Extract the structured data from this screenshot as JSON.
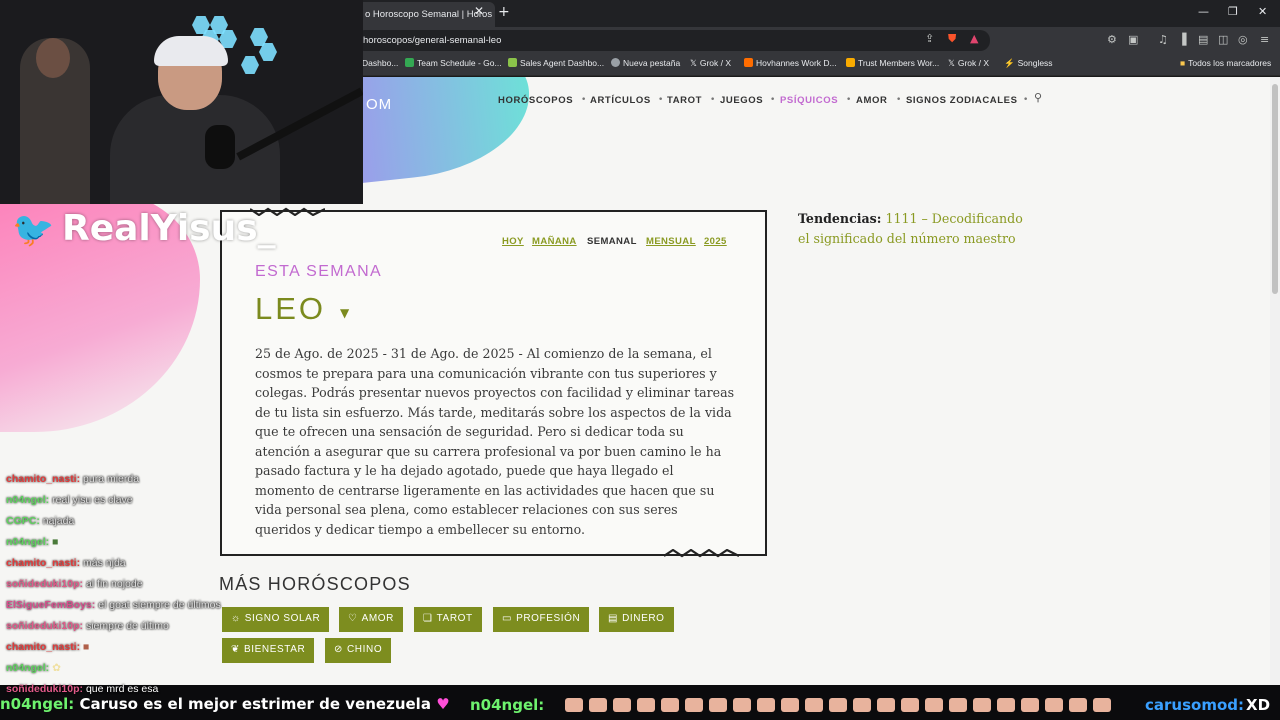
{
  "browser": {
    "tab_title": "o Horoscopo Semanal | Horos",
    "url": "horoscopos/general-semanal-leo",
    "bookmarks": [
      {
        "label": "Dashbo...",
        "color": "#4caf50"
      },
      {
        "label": "Team Schedule - Go...",
        "color": "#34a853"
      },
      {
        "label": "Sales Agent Dashbo...",
        "color": "#8bc34a"
      },
      {
        "label": "Nueva pestaña",
        "color": "#9aa0a6"
      },
      {
        "label": "Grok / X",
        "color": "#e8eaed"
      },
      {
        "label": "Hovhannes Work D...",
        "color": "#ff6d00"
      },
      {
        "label": "Trust Members Wor...",
        "color": "#f9ab00"
      },
      {
        "label": "Grok / X",
        "color": "#e8eaed"
      },
      {
        "label": "Songless",
        "color": "#c6ff00"
      }
    ],
    "all_bookmarks": "Todos los marcadores"
  },
  "site": {
    "logo_fragment": "OM",
    "nav": [
      "HORÓSCOPOS",
      "ARTÍCULOS",
      "TAROT",
      "JUEGOS",
      "PSÍQUICOS",
      "AMOR",
      "SIGNOS ZODIACALES"
    ],
    "nav_active_color": "#c26ad0"
  },
  "card": {
    "periods": {
      "hoy": "HOY",
      "manana": "MAÑANA",
      "semanal": "SEMANAL",
      "mensual": "MENSUAL",
      "year": "2025"
    },
    "week_label": "ESTA SEMANA",
    "sign": "LEO",
    "horoscope": "25 de Ago. de 2025 - 31 de Ago. de 2025 - Al comienzo de la semana, el cosmos te prepara para una comunicación vibrante con tus superiores y colegas. Podrás presentar nuevos proyectos con facilidad y eliminar tareas de tu lista sin esfuerzo. Más tarde, meditarás sobre los aspectos de la vida que te ofrecen una sensación de seguridad. Pero si dedicar toda su atención a asegurar que su carrera profesional va por buen camino le ha pasado factura y le ha dejado agotado, puede que haya llegado el momento de centrarse ligeramente en las actividades que hacen que su vida personal sea plena, como establecer relaciones con sus seres queridos y dedicar tiempo a embellecer su entorno."
  },
  "trends": {
    "label": "Tendencias:",
    "link": "1111 – Decodificando el significado del número maestro"
  },
  "more": {
    "title": "MÁS HORÓSCOPOS",
    "categories": [
      "SIGNO SOLAR",
      "AMOR",
      "TAROT",
      "PROFESIÓN",
      "DINERO",
      "BIENESTAR",
      "CHINO"
    ]
  },
  "stream": {
    "handle": "RealYisus_",
    "chat": [
      {
        "user": "chamito_nasti:",
        "msg": "pura mierda",
        "color": "#e23a3a"
      },
      {
        "user": "n04ngel:",
        "msg": "real yisu es clave",
        "color": "#5fd35f"
      },
      {
        "user": "CGPC:",
        "msg": "najada",
        "color": "#5fd35f"
      },
      {
        "user": "n04ngel:",
        "msg": "",
        "color": "#5fd35f"
      },
      {
        "user": "chamito_nasti:",
        "msg": "más njda",
        "color": "#e23a3a"
      },
      {
        "user": "soñideduki10p:",
        "msg": "al fin nojode",
        "color": "#e25a8a"
      },
      {
        "user": "ElSigueFemBoys:",
        "msg": "el goat siempre de últimos",
        "color": "#d8508e"
      },
      {
        "user": "soñideduki10p:",
        "msg": "siempre de último",
        "color": "#e25a8a"
      },
      {
        "user": "chamito_nasti:",
        "msg": "",
        "color": "#e23a3a"
      },
      {
        "user": "n04ngel:",
        "msg": "",
        "color": "#5fd35f"
      },
      {
        "user": "soñideduki10p:",
        "msg": "que mrd es esa",
        "color": "#e25a8a"
      }
    ],
    "ticker_left_user": "n04ngel:",
    "ticker_left_msg": "Caruso es el mejor estrimer de venezuela",
    "ticker_mid_user": "n04ngel:",
    "ticker_right_user": "carusomod:",
    "ticker_right_msg": "XD"
  }
}
